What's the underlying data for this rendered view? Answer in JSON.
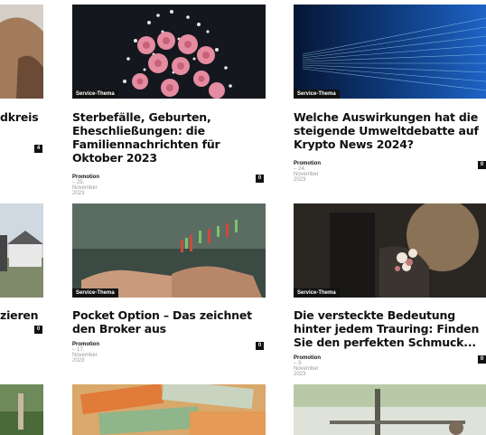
{
  "tag_label": "Service-Thema",
  "row1": {
    "left": {
      "title_fragment": "dkreis",
      "count": "4"
    },
    "mid": {
      "title": "Sterbefälle, Geburten, Eheschließungen: die Familiennachrichten für Oktober 2023",
      "author": "Promotion",
      "date": "25. November 2023",
      "count": "0"
    },
    "right": {
      "title": "Welche Auswirkungen hat die steigende Umweltdebatte auf Krypto News 2024?",
      "author": "Promotion",
      "date": "24. November 2023",
      "count": "0"
    }
  },
  "row2": {
    "left": {
      "title_fragment": "zieren",
      "count": "0"
    },
    "mid": {
      "title": "Pocket Option – Das zeichnet den Broker aus",
      "author": "Promotion",
      "date": "17. November 2023",
      "count": "0"
    },
    "right": {
      "title": "Die versteckte Bedeutung hinter jedem Trauring: Finden Sie den perfekten Schmuck...",
      "author": "Promotion",
      "date": "3. November 2023",
      "count": "0"
    }
  }
}
